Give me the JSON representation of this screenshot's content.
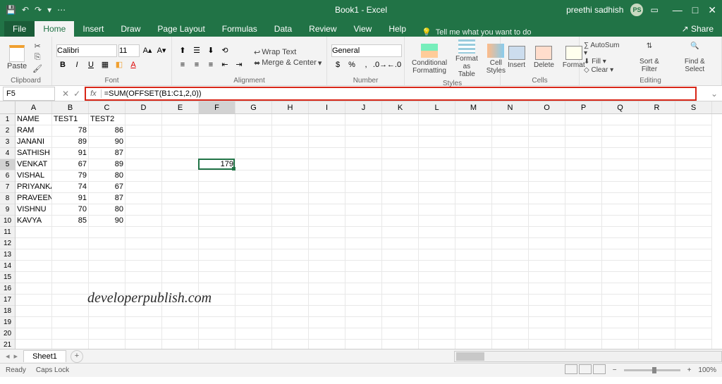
{
  "title": "Book1 - Excel",
  "user": {
    "name": "preethi sadhish",
    "initials": "PS"
  },
  "tabs": [
    "File",
    "Home",
    "Insert",
    "Draw",
    "Page Layout",
    "Formulas",
    "Data",
    "Review",
    "View",
    "Help"
  ],
  "active_tab": "Home",
  "tell_me": "Tell me what you want to do",
  "share": "Share",
  "ribbon": {
    "clipboard": {
      "label": "Clipboard",
      "paste": "Paste"
    },
    "font": {
      "label": "Font",
      "name": "Calibri",
      "size": "11"
    },
    "alignment": {
      "label": "Alignment",
      "wrap": "Wrap Text",
      "merge": "Merge & Center"
    },
    "number": {
      "label": "Number",
      "format": "General"
    },
    "styles": {
      "label": "Styles",
      "cond": "Conditional Formatting",
      "table": "Format as Table",
      "cell": "Cell Styles"
    },
    "cells": {
      "label": "Cells",
      "insert": "Insert",
      "delete": "Delete",
      "format": "Format"
    },
    "editing": {
      "label": "Editing",
      "autosum": "AutoSum",
      "fill": "Fill",
      "clear": "Clear",
      "sort": "Sort & Filter",
      "find": "Find & Select"
    }
  },
  "name_box": "F5",
  "formula": "=SUM(OFFSET(B1:C1,2,0))",
  "columns": [
    "A",
    "B",
    "C",
    "D",
    "E",
    "F",
    "G",
    "H",
    "I",
    "J",
    "K",
    "L",
    "M",
    "N",
    "O",
    "P",
    "Q",
    "R",
    "S"
  ],
  "active_col": "F",
  "active_row": 5,
  "data_rows": [
    {
      "A": "NAME",
      "B": "TEST1",
      "C": "TEST2"
    },
    {
      "A": "RAM",
      "B": "78",
      "C": "86"
    },
    {
      "A": "JANANI",
      "B": "89",
      "C": "90"
    },
    {
      "A": "SATHISH",
      "B": "91",
      "C": "87"
    },
    {
      "A": "VENKAT",
      "B": "67",
      "C": "89",
      "F": "179"
    },
    {
      "A": "VISHAL",
      "B": "79",
      "C": "80"
    },
    {
      "A": "PRIYANKA",
      "B": "74",
      "C": "67"
    },
    {
      "A": "PRAVEEN",
      "B": "91",
      "C": "87"
    },
    {
      "A": "VISHNU",
      "B": "70",
      "C": "80"
    },
    {
      "A": "KAVYA",
      "B": "85",
      "C": "90"
    }
  ],
  "total_rows": 21,
  "watermark": "developerpublish.com",
  "sheet_name": "Sheet1",
  "status": {
    "ready": "Ready",
    "caps": "Caps Lock",
    "zoom": "100%"
  }
}
